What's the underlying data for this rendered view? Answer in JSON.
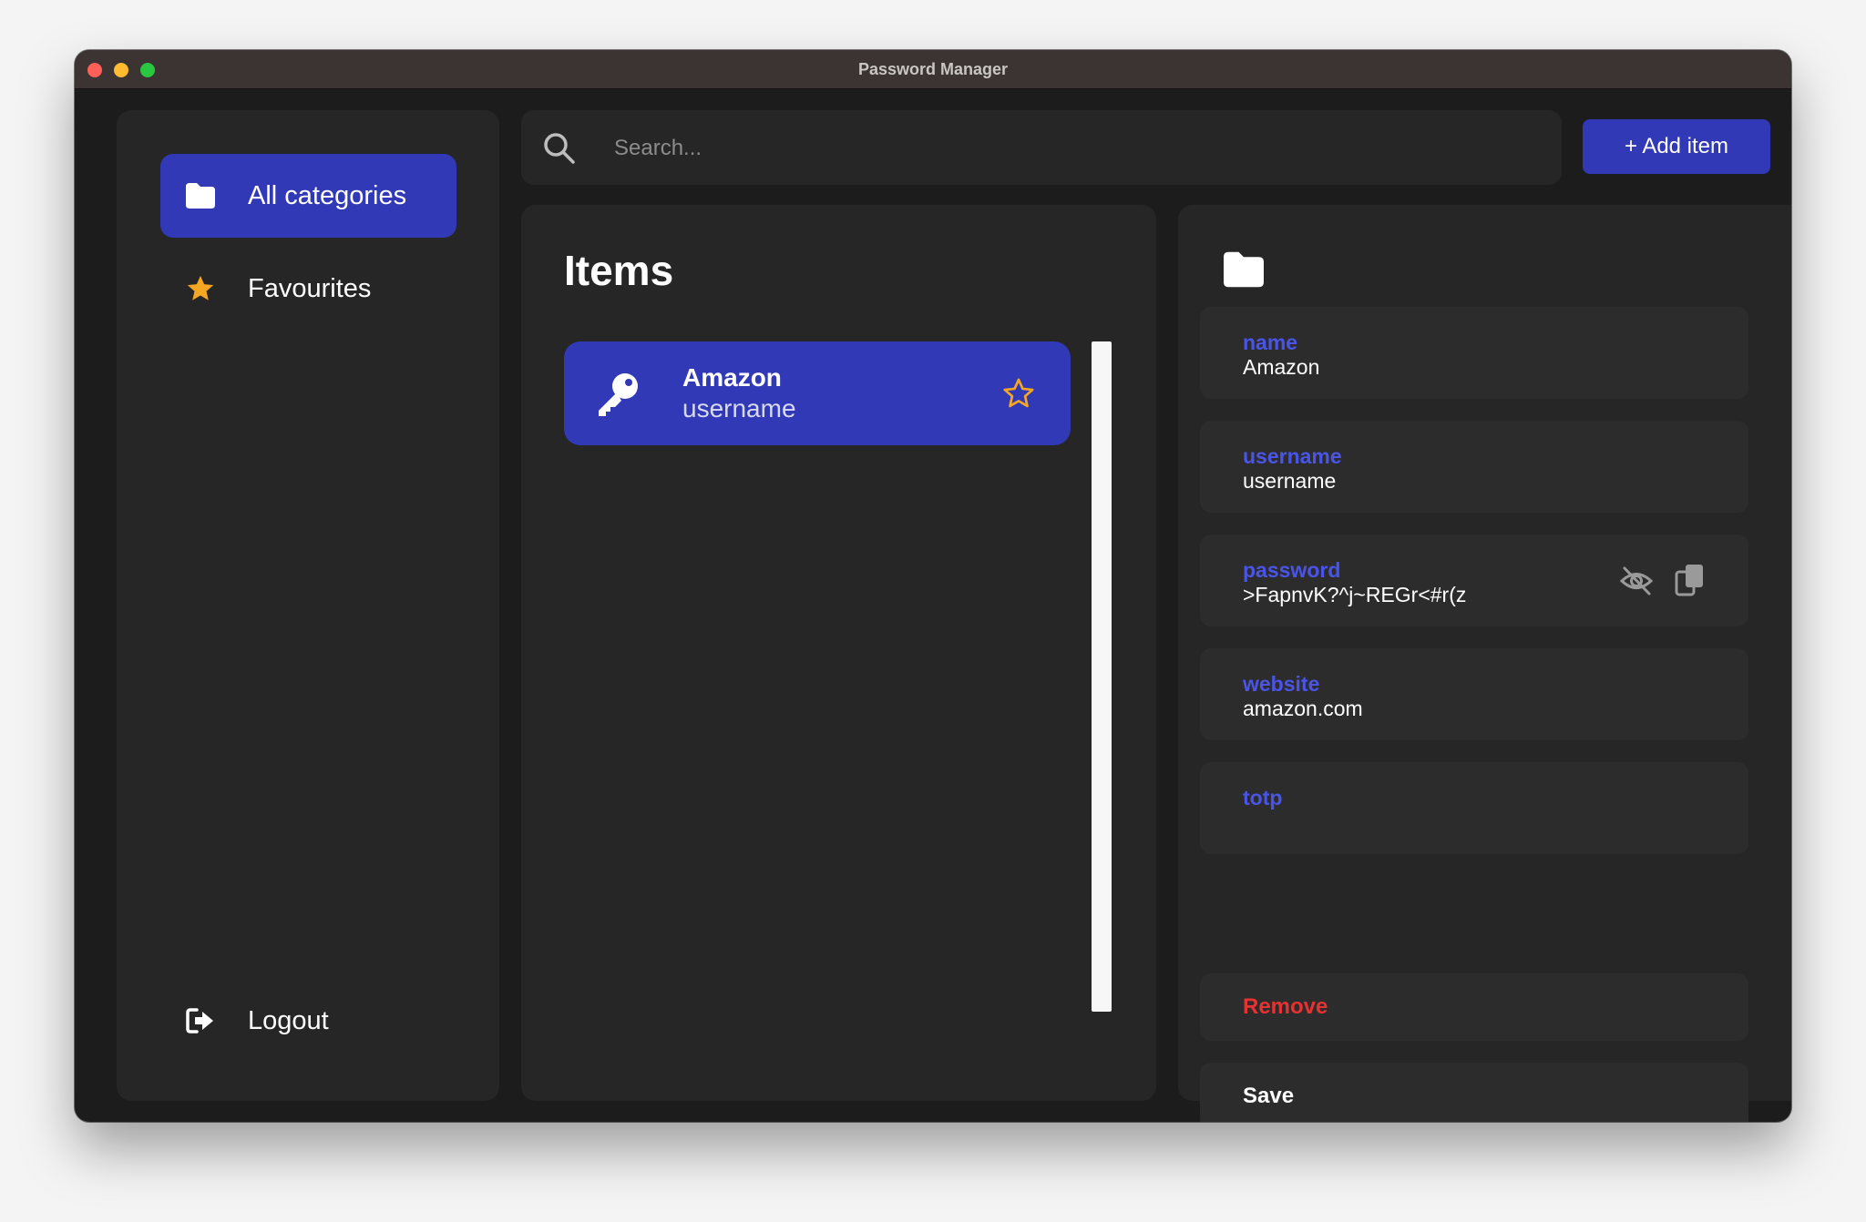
{
  "window": {
    "title": "Password Manager"
  },
  "sidebar": {
    "items": [
      {
        "label": "All categories",
        "icon": "folder-icon",
        "active": true
      },
      {
        "label": "Favourites",
        "icon": "star-icon",
        "active": false
      }
    ],
    "logout_label": "Logout"
  },
  "search": {
    "placeholder": "Search...",
    "value": ""
  },
  "toolbar": {
    "add_label": "+ Add item"
  },
  "items_list": {
    "title": "Items",
    "items": [
      {
        "name": "Amazon",
        "subtitle": "username",
        "icon": "key-icon",
        "favourite": false
      }
    ]
  },
  "detail": {
    "icon": "folder-icon",
    "fields": {
      "name": {
        "label": "name",
        "value": "Amazon"
      },
      "username": {
        "label": "username",
        "value": "username"
      },
      "password": {
        "label": "password",
        "value": ">FapnvK?^j~REGr<#r(z"
      },
      "website": {
        "label": "website",
        "value": "amazon.com"
      },
      "totp": {
        "label": "totp",
        "value": ""
      }
    },
    "remove_label": "Remove",
    "save_label": "Save"
  },
  "colors": {
    "accent": "#3139b7",
    "field_label": "#4a55e8",
    "danger": "#e63232",
    "star": "#f5a623",
    "panel": "#262626",
    "background": "#1c1c1c"
  }
}
